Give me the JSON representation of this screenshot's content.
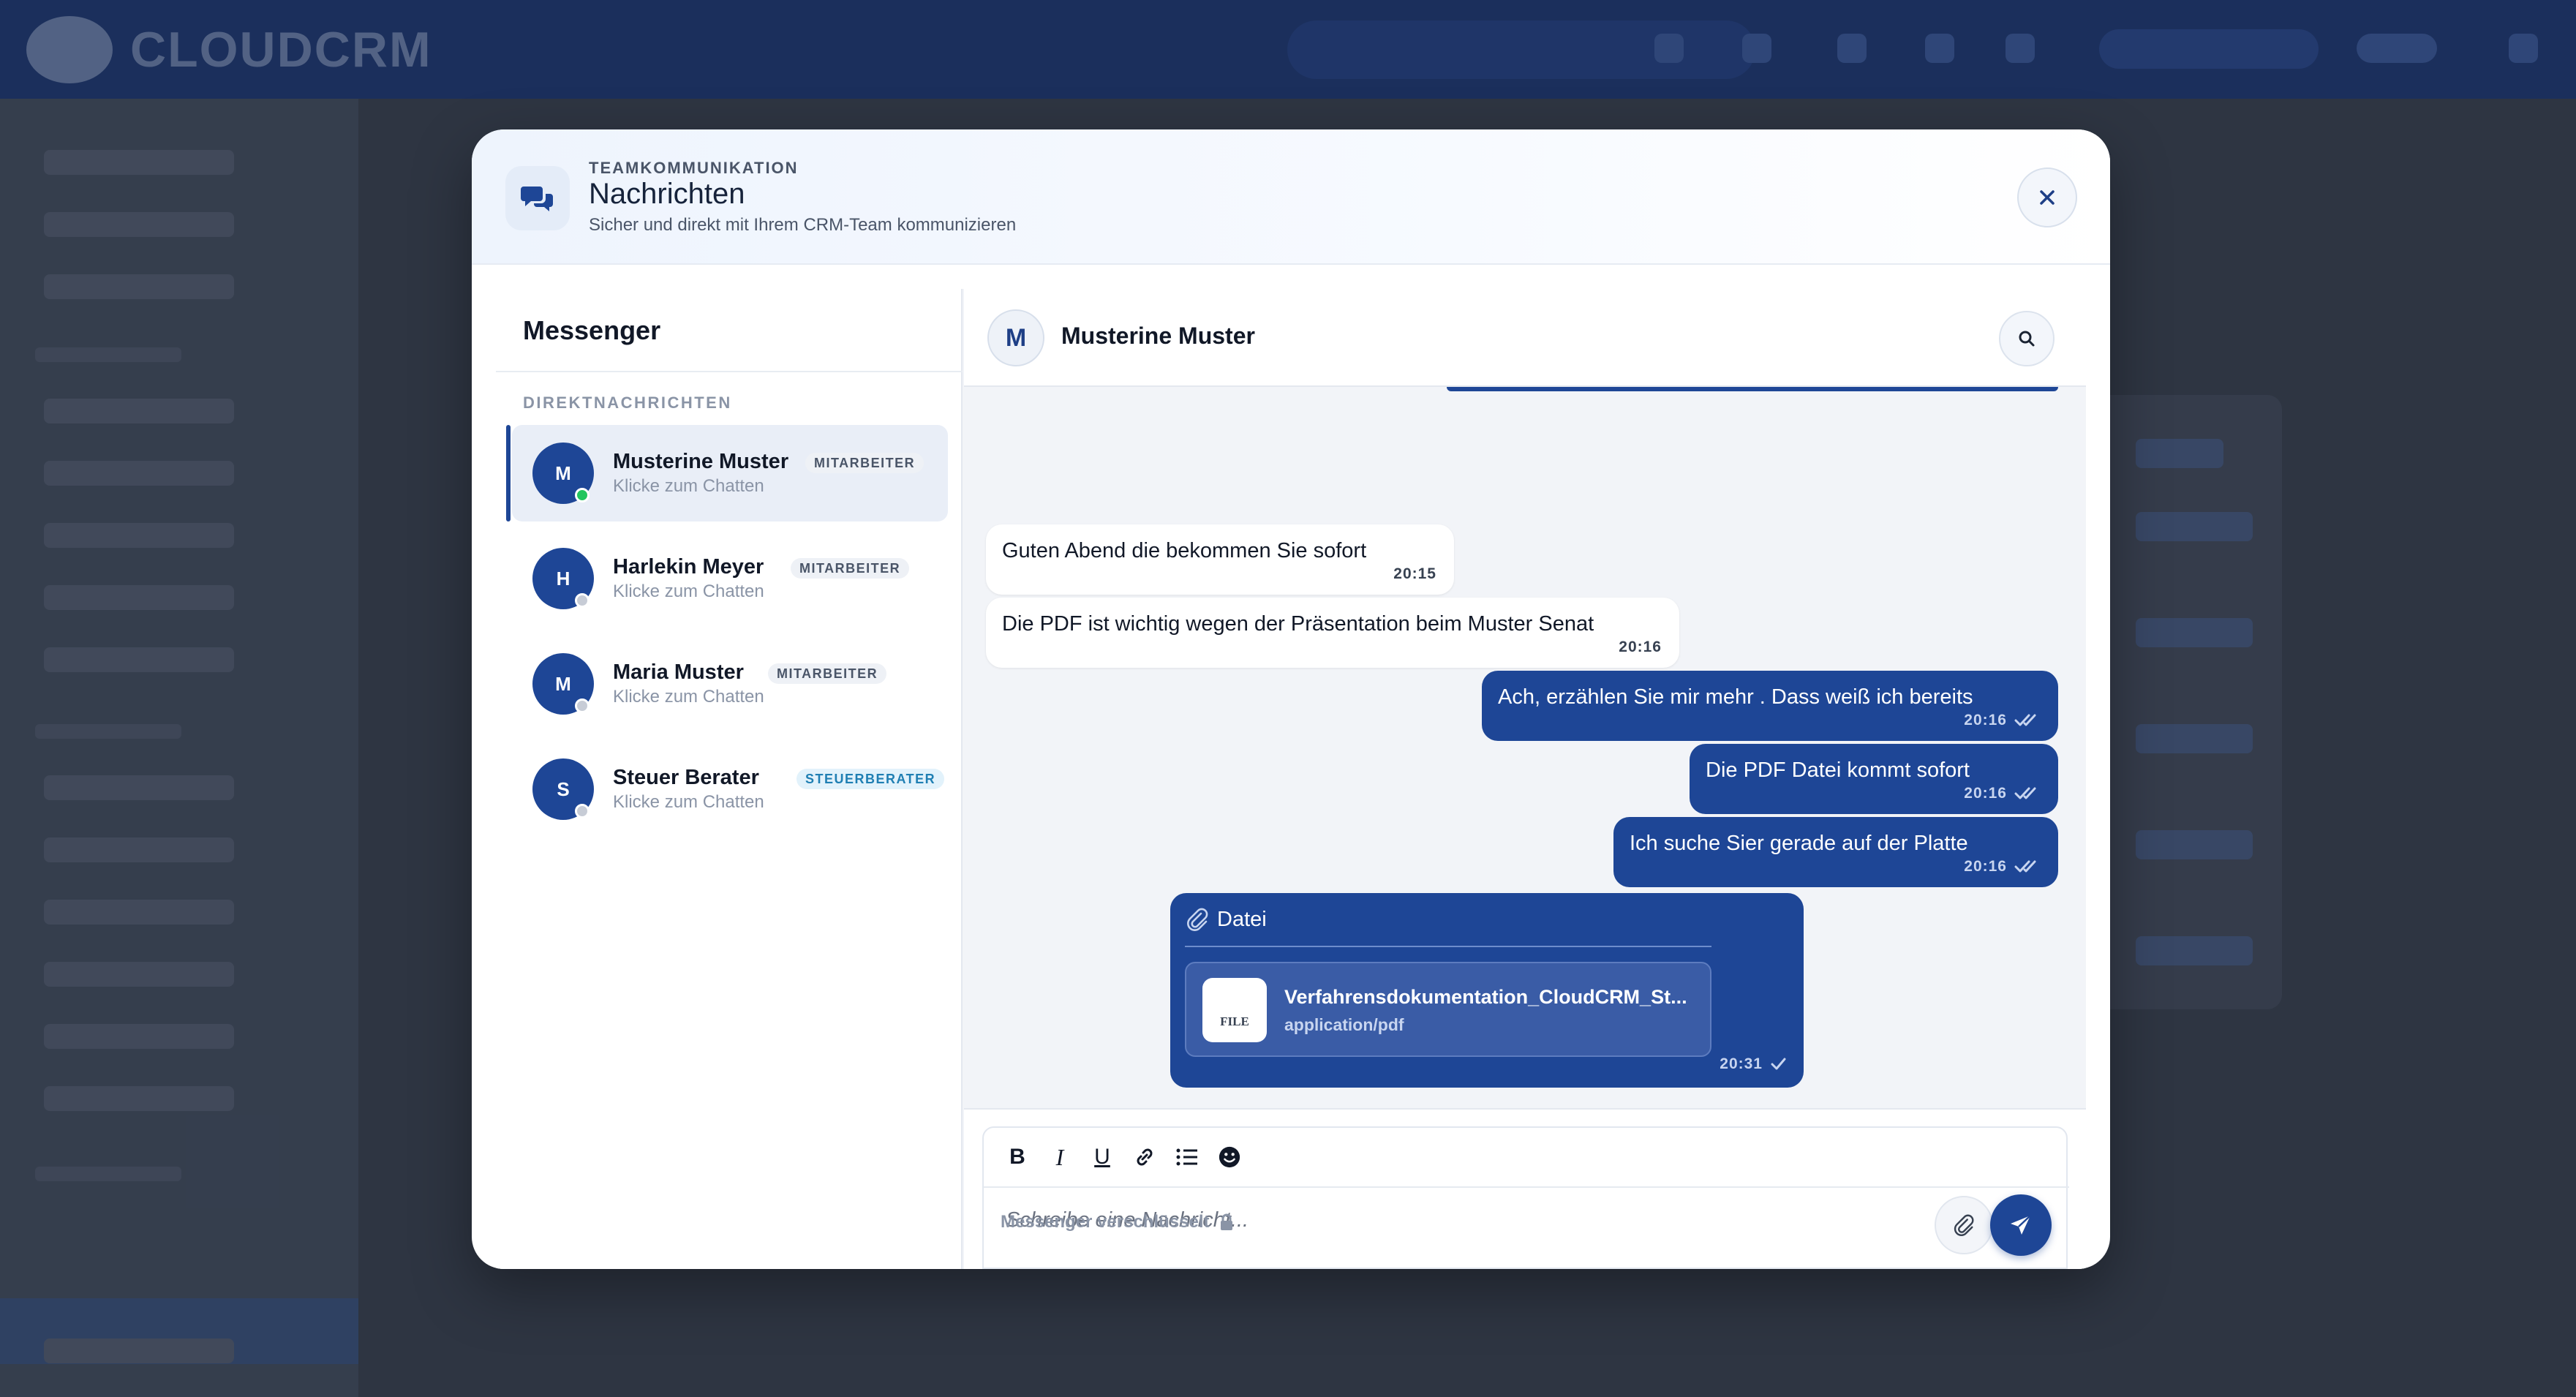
{
  "background_app": {
    "brand": "CLOUDCRM"
  },
  "modal": {
    "eyebrow": "TEAMKOMMUNIKATION",
    "title": "Nachrichten",
    "subtitle": "Sicher und direkt mit Ihrem CRM-Team kommunizieren",
    "close_icon": "close-icon",
    "header_icon": "chat-bubbles-icon"
  },
  "sidebar": {
    "title": "Messenger",
    "section_label": "DIREKTNACHRICHTEN",
    "contacts": [
      {
        "initial": "M",
        "name": "Musterine Muster",
        "role": "MITARBEITER",
        "sub": "Klicke zum Chatten",
        "online": true,
        "active": true
      },
      {
        "initial": "H",
        "name": "Harlekin Meyer",
        "role": "MITARBEITER",
        "sub": "Klicke zum Chatten",
        "online": false,
        "active": false
      },
      {
        "initial": "M",
        "name": "Maria Muster",
        "role": "MITARBEITER",
        "sub": "Klicke zum Chatten",
        "online": false,
        "active": false
      },
      {
        "initial": "S",
        "name": "Steuer Berater",
        "role": "STEUERBERATER",
        "sub": "Klicke zum Chatten",
        "online": false,
        "active": false
      }
    ]
  },
  "chat": {
    "partner_initial": "M",
    "partner_name": "Musterine Muster",
    "messages": [
      {
        "direction": "in",
        "text": "Guten Abend die bekommen Sie sofort",
        "time": "20:15"
      },
      {
        "direction": "in",
        "text": "Die PDF ist wichtig wegen der Präsentation beim Muster Senat",
        "time": "20:16"
      },
      {
        "direction": "out",
        "text": "Ach, erzählen Sie mir mehr . Dass weiß ich bereits",
        "time": "20:16",
        "status": "read"
      },
      {
        "direction": "out",
        "text": "Die PDF Datei kommt sofort",
        "time": "20:16",
        "status": "read"
      },
      {
        "direction": "out",
        "text": "Ich suche Sier gerade auf der Platte",
        "time": "20:16",
        "status": "read"
      }
    ],
    "file_message": {
      "label": "Datei",
      "file_name": "Verfahrensdokumentation_CloudCRM_St...",
      "file_type": "application/pdf",
      "file_icon_text": "FILE",
      "time": "20:31",
      "status": "sent"
    }
  },
  "composer": {
    "toolbar": [
      "bold-icon",
      "italic-icon",
      "underline-icon",
      "link-icon",
      "list-icon",
      "emoji-icon"
    ],
    "bold": "B",
    "italic": "I",
    "underline": "U",
    "placeholder": "Schreibe eine Nachricht...",
    "encryption_note": "Messenger verschlüsselt"
  },
  "colors": {
    "primary": "#1e4696",
    "online": "#22c55e",
    "tax_badge": "#1f7fb3"
  }
}
